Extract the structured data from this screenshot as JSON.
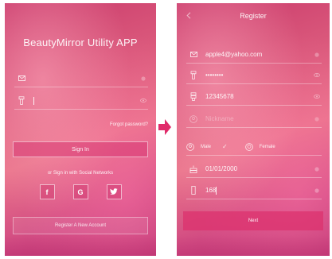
{
  "login": {
    "app_title": "BeautyMirror Utility APP",
    "forgot_password": "Forgot password?",
    "sign_in": "Sign In",
    "social_label": "or Sign in with Social Networks",
    "social": [
      "f",
      "G",
      "t"
    ],
    "register": "Register A New Account",
    "password_value": ""
  },
  "register": {
    "title": "Register",
    "email": "apple4@yahoo.com",
    "password": "••••••••",
    "phone": "12345678",
    "name_placeholder": "Nickname",
    "gender_male": "Male",
    "gender_female": "Female",
    "birthday": "01/01/2000",
    "height": "168",
    "next": "Next"
  },
  "colors": {
    "arrow": "#e02b6a",
    "bg_top": "#c93a6b",
    "bg_bottom": "#b8306f"
  }
}
